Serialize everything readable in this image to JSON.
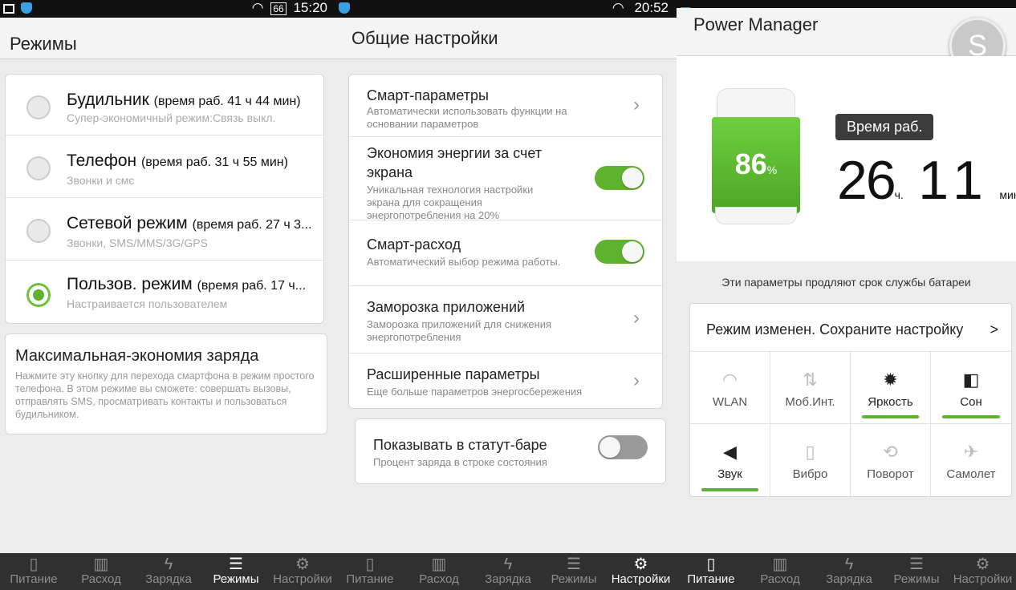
{
  "panel1": {
    "status": {
      "time": "15:20",
      "battery": "66"
    },
    "header": "Режимы",
    "modes": [
      {
        "title": "Будильник",
        "time": "(время раб. 41 ч 44 мин)",
        "sub": "Супер-экономичный режим:Связь выкл.",
        "selected": false
      },
      {
        "title": "Телефон",
        "time": "(время раб. 31 ч 55 мин)",
        "sub": "Звонки и смс",
        "selected": false
      },
      {
        "title": "Сетевой режим",
        "time": "(время раб. 27 ч 3...",
        "sub": "Звонки, SMS/MMS/3G/GPS",
        "selected": false
      },
      {
        "title": "Пользов. режим",
        "time": "(время раб. 17 ч...",
        "sub": "Настраивается пользователем",
        "selected": true
      }
    ],
    "max_saving": {
      "title": "Максимальная-экономия заряда",
      "desc": "Нажмите эту кнопку для перехода смартфона в режим простого телефона. В этом режиме вы сможете: совершать вызовы, отправлять SMS, просматривать контакты и пользоваться будильником."
    },
    "tabs": [
      "Питание",
      "Расход",
      "Зарядка",
      "Режимы",
      "Настройки"
    ],
    "active_tab": "Режимы"
  },
  "panel2": {
    "status": {
      "time": "20:52"
    },
    "header": "Общие настройки",
    "items": [
      {
        "title": "Смарт-параметры",
        "sub": "Автоматически использовать функции на основании параметров",
        "control": "chevron"
      },
      {
        "title": "Экономия энергии за счет экрана",
        "sub": "Уникальная технология настройки экрана для сокращения энергопотребления на 20%",
        "control": "toggle-on"
      },
      {
        "title": "Смарт-расход",
        "sub": "Автоматический выбор режима работы.",
        "control": "toggle-on"
      },
      {
        "title": "Заморозка приложений",
        "sub": "Заморозка приложений для снижения энергопотребления",
        "control": "chevron"
      },
      {
        "title": "Расширенные параметры",
        "sub": "Еще больше параметров энергосбережения",
        "control": "chevron"
      }
    ],
    "status_bar_item": {
      "title": "Показывать в статут-баре",
      "sub": "Процент заряда в строке состояния",
      "control": "toggle-off"
    },
    "tabs": [
      "Питание",
      "Расход",
      "Зарядка",
      "Режимы",
      "Настройки"
    ],
    "active_tab": "Настройки"
  },
  "panel3": {
    "header": "Power Manager",
    "avatar": "S",
    "battery_pct": "86",
    "battery_pct_unit": "%",
    "runtime_label": "Время раб.",
    "hours": "26",
    "hours_unit": "ч.",
    "minutes": "11",
    "minutes_unit": "мин.",
    "hint": "Эти параметры продляют срок службы батареи",
    "mode_changed": "Режим изменен. Сохраните настройку",
    "mode_changed_arrow": ">",
    "quick": [
      {
        "label": "WLAN",
        "icon": "wifi-icon",
        "glyph": "◠",
        "on": false
      },
      {
        "label": "Моб.Инт.",
        "icon": "mobile-data-icon",
        "glyph": "⇅",
        "on": false
      },
      {
        "label": "Яркость",
        "icon": "brightness-icon",
        "glyph": "✹",
        "on": true
      },
      {
        "label": "Сон",
        "icon": "sleep-icon",
        "glyph": "◧",
        "on": true
      },
      {
        "label": "Звук",
        "icon": "sound-icon",
        "glyph": "◀",
        "on": true
      },
      {
        "label": "Вибро",
        "icon": "vibrate-icon",
        "glyph": "▯",
        "on": false
      },
      {
        "label": "Поворот",
        "icon": "rotate-icon",
        "glyph": "⟲",
        "on": false
      },
      {
        "label": "Самолет",
        "icon": "airplane-icon",
        "glyph": "✈",
        "on": false
      }
    ],
    "tabs": [
      "Питание",
      "Расход",
      "Зарядка",
      "Режимы",
      "Настройки"
    ],
    "active_tab": "Питание"
  },
  "colors": {
    "accent_green": "#5fb22e",
    "navbar": "#303030"
  }
}
